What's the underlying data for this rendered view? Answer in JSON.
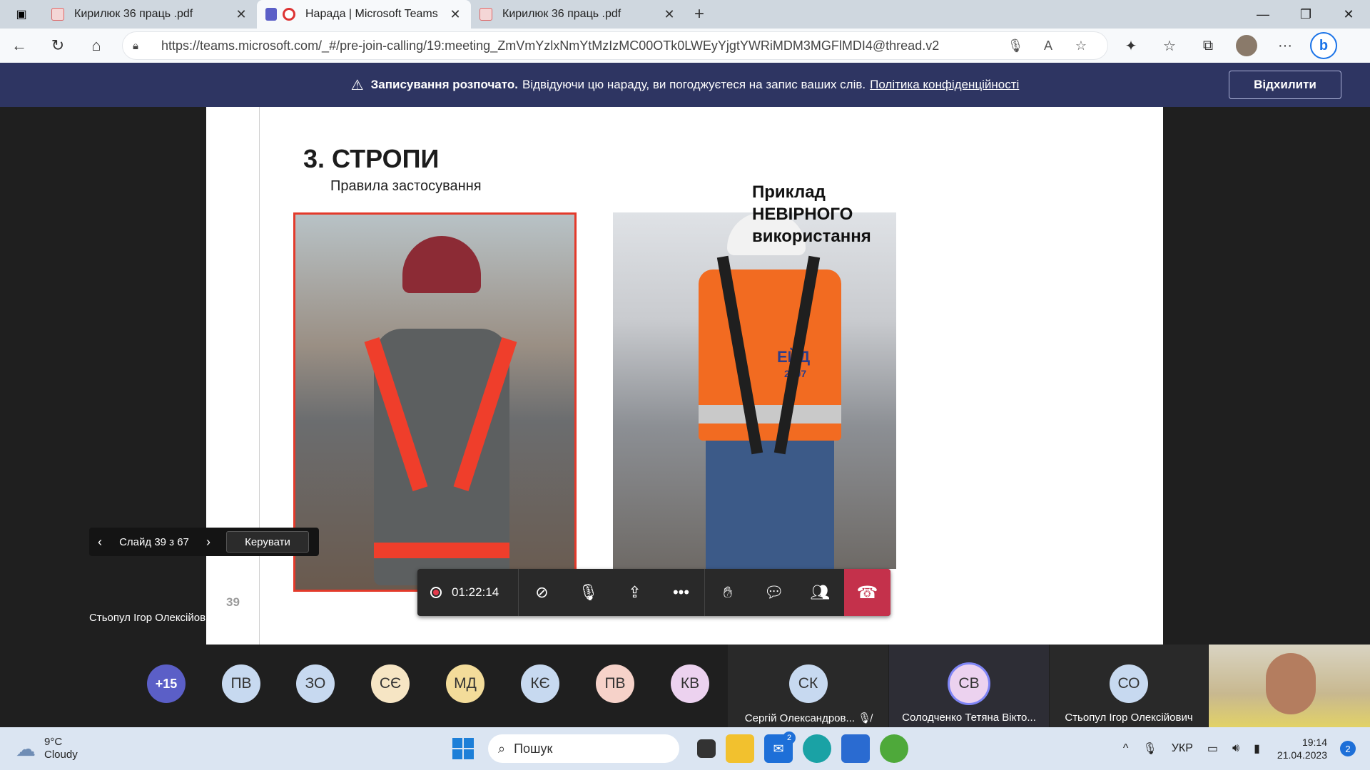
{
  "browser": {
    "tabs": [
      {
        "label": "Кирилюк 36 праць .pdf",
        "active": false
      },
      {
        "label": "Нарада | Microsoft Teams",
        "active": true
      },
      {
        "label": "Кирилюк 36 праць .pdf",
        "active": false
      }
    ],
    "url": "https://teams.microsoft.com/_#/pre-join-calling/19:meeting_ZmVmYzlxNmYtMzIzMC00OTk0LWEyYjgtYWRiMDM3MGFlMDI4@thread.v2"
  },
  "banner": {
    "bold": "Записування розпочато.",
    "text": "Відвідуючи цю нараду, ви погоджуєтеся на запис ваших слів.",
    "link": "Політика конфіденційності",
    "dismiss": "Відхилити"
  },
  "slide": {
    "title": "3. СТРОПИ",
    "subtitle": "Правила застосування",
    "caption_line1": "Приклад",
    "caption_line2": "НЕВІРНОГО",
    "caption_line3": "використання",
    "page_number": "39",
    "photo2_vest_text": "ЕЙД",
    "photo2_vest_year": "2007"
  },
  "slide_nav": {
    "counter": "Слайд 39 з 67",
    "control": "Керувати"
  },
  "presenter": "Стьопул Ігор Олексійович",
  "call": {
    "timer": "01:22:14"
  },
  "gallery": {
    "more": "+15",
    "avatars": [
      {
        "initials": "ПВ",
        "color": "#c7d9f0"
      },
      {
        "initials": "ЗО",
        "color": "#c7d9f0"
      },
      {
        "initials": "СЄ",
        "color": "#f6e5c4"
      },
      {
        "initials": "МД",
        "color": "#f3dc9a"
      },
      {
        "initials": "КЄ",
        "color": "#c7d9f0"
      },
      {
        "initials": "ПВ",
        "color": "#f6d2c9"
      },
      {
        "initials": "КВ",
        "color": "#ecd2ef"
      }
    ],
    "tiles": [
      {
        "initials": "СК",
        "name": "Сергій Олександров..."
      },
      {
        "initials": "СВ",
        "name": "Солодченко Тетяна Вікто..."
      },
      {
        "initials": "СО",
        "name": "Стьопул Ігор Олексійович"
      }
    ]
  },
  "taskbar": {
    "temp": "9°C",
    "weather": "Cloudy",
    "search": "Пошук",
    "lang": "УКР",
    "time": "19:14",
    "date": "21.04.2023",
    "mail_badge": "2",
    "notifications": "2"
  },
  "colors": {
    "banner": "#2e3562",
    "hangup": "#c4314b",
    "slide_accent": "#e33a2b",
    "more_avatar": "#5b5fc7"
  }
}
